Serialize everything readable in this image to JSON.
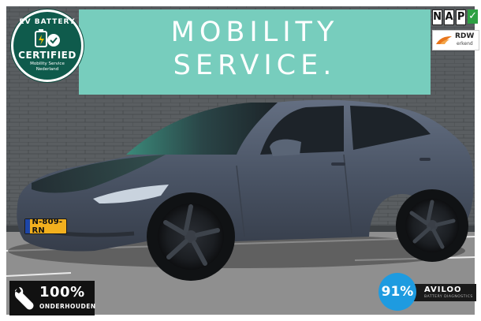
{
  "photo": {
    "subject": "grey sedan parked in front of building",
    "sign": {
      "line1": "MOBILITY",
      "line2": "SERVICE."
    },
    "ev_badge": {
      "top": "EV BATTERY",
      "main": "CERTIFIED",
      "sub1": "Mobility Service",
      "sub2": "Nederland",
      "icon": "battery-check-icon"
    },
    "nap": {
      "letters": [
        "N",
        "A",
        "P"
      ],
      "check_icon": "checkmark-icon"
    },
    "rdw": {
      "main": "RDW",
      "sub": "erkend",
      "icon": "rdw-logo-icon"
    },
    "plate": {
      "text": "N-809-RN"
    },
    "maintenance": {
      "percent": "100%",
      "label": "ONDERHOUDEN",
      "icon": "wrench-icon"
    },
    "battery_score": {
      "value": "91%",
      "brand": "AVILOO",
      "subtitle": "BATTERY DIAGNOSTICS"
    },
    "colors": {
      "sign_bg": "#77cdbd",
      "wall": "#55595c",
      "car_body": "#4a5465",
      "asphalt": "#8f8f8f",
      "ev_green": "#0f5b4c",
      "aviloo_blue": "#1e9be0"
    }
  }
}
